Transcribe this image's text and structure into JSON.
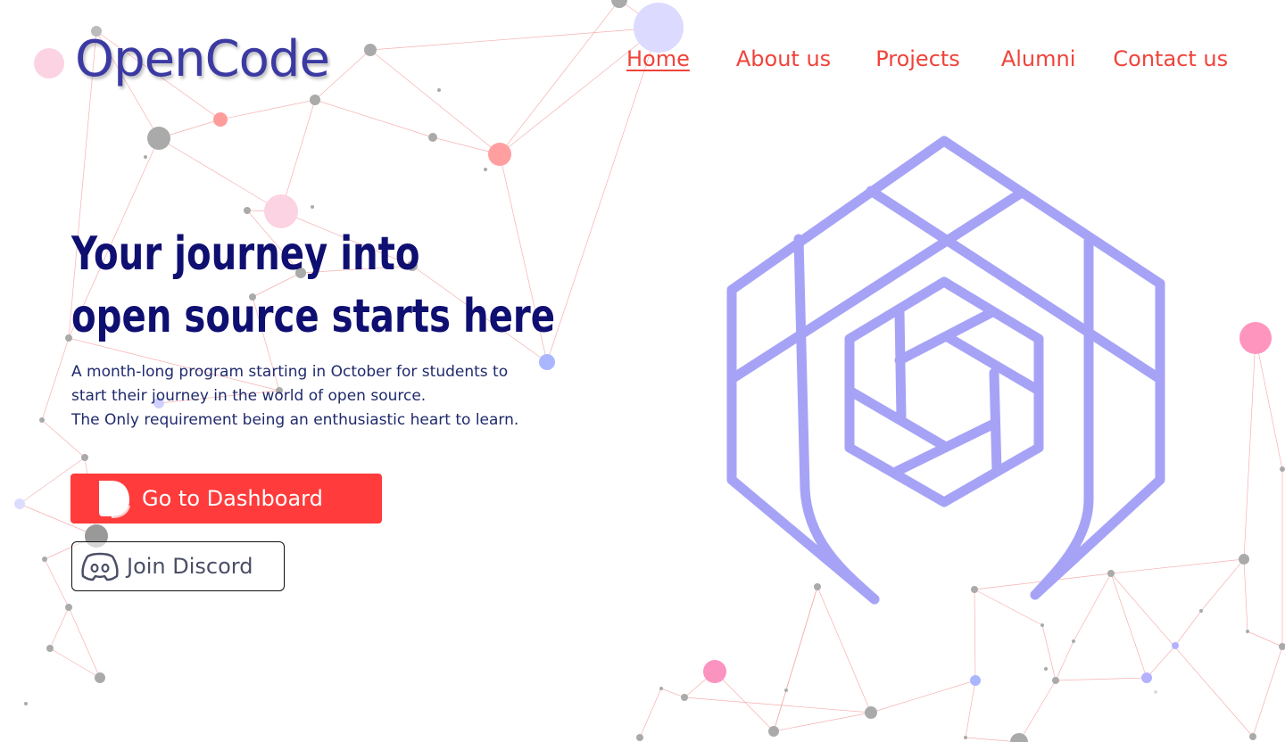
{
  "brand": {
    "logo_text": "OpenCode"
  },
  "nav": {
    "items": [
      {
        "label": "Home",
        "active": true
      },
      {
        "label": "About us",
        "active": false
      },
      {
        "label": "Projects",
        "active": false
      },
      {
        "label": "Alumni",
        "active": false
      },
      {
        "label": "Contact us",
        "active": false
      }
    ]
  },
  "hero": {
    "headline_line1": "Your journey into",
    "headline_line2": "open source starts here",
    "description_line1": "A month-long program starting in October for students to start their journey in the world of open source.",
    "description_line2": "The Only requirement being an enthusiastic heart to learn.",
    "primary_button": {
      "label": "Go to Dashboard",
      "icon": "dashboard-icon"
    },
    "secondary_button": {
      "label": "Join Discord",
      "icon": "discord-icon"
    }
  },
  "colors": {
    "primary": "#ff3b3b",
    "nav_text": "#f0433a",
    "headline": "#0f0f72",
    "logo": "#3b3aa3",
    "hero_graphic": "#a6a3f7"
  }
}
